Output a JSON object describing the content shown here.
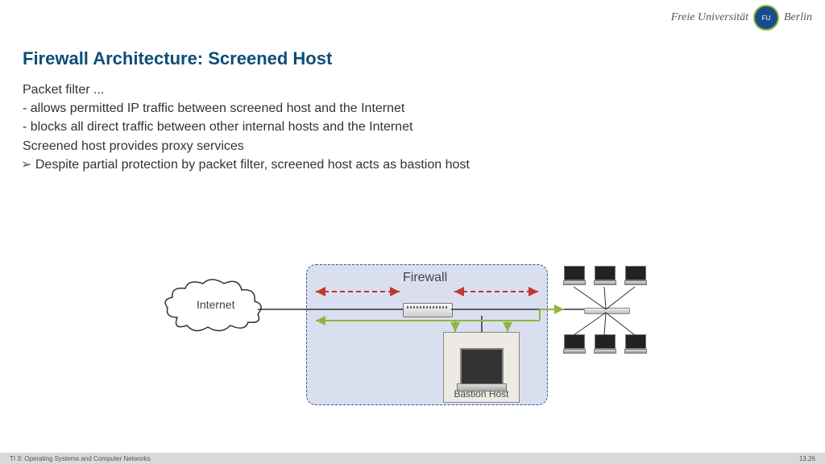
{
  "logo": {
    "text_left": "Freie Universität",
    "text_right": "Berlin"
  },
  "title": "Firewall Architecture: Screened Host",
  "bullets": {
    "intro": "Packet filter ...",
    "p1": "allows permitted IP traffic between screened host and the Internet",
    "p2": "blocks all direct traffic between other internal hosts and the Internet",
    "line3": "Screened host provides proxy services",
    "line4": "Despite partial protection by packet filter, screened host acts as bastion host"
  },
  "diagram": {
    "internet": "Internet",
    "firewall": "Firewall",
    "bastion": "Bastion Host"
  },
  "footer": {
    "left": "TI 3: Operating Systems and Computer Networks",
    "right": "13.26"
  }
}
